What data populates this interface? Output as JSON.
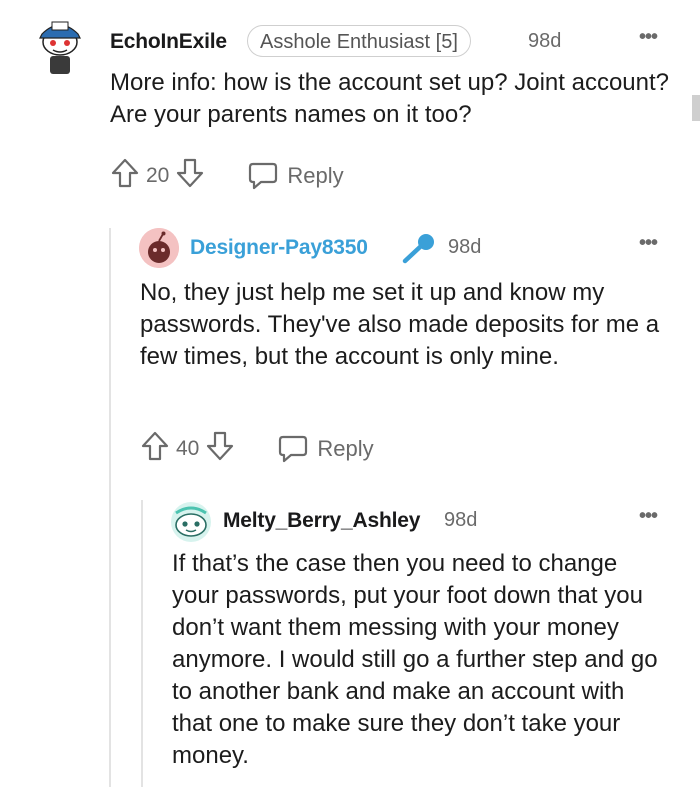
{
  "comments": [
    {
      "username": "EchoInExile",
      "flair": "Asshole Enthusiast [5]",
      "time": "98d",
      "more": "•••",
      "body": "More info: how is the account set up? Joint account? Are your parents names on it too?",
      "votes": "20",
      "reply_label": "Reply"
    },
    {
      "username": "Designer-Pay8350",
      "time": "98d",
      "more": "•••",
      "body": "No, they just help me set it up and know my passwords. They've also made deposits for me a few times, but the account is only mine.",
      "votes": "40",
      "reply_label": "Reply",
      "username_color": "#3aa0d8"
    },
    {
      "username": "Melty_Berry_Ashley",
      "time": "98d",
      "more": "•••",
      "body": "If that’s the case then you need to change your passwords, put your foot down that you don’t want them messing with your money anymore. I would still go a further step and go to another bank and make an account with that one to make sure they don’t take your money."
    }
  ],
  "icons": {
    "upvote": "arrow-up-icon",
    "downvote": "arrow-down-icon",
    "reply": "speech-bubble-icon",
    "mic": "microphone-icon"
  },
  "colors": {
    "op_accent": "#3aa0d8",
    "muted": "#6a6a6a"
  }
}
